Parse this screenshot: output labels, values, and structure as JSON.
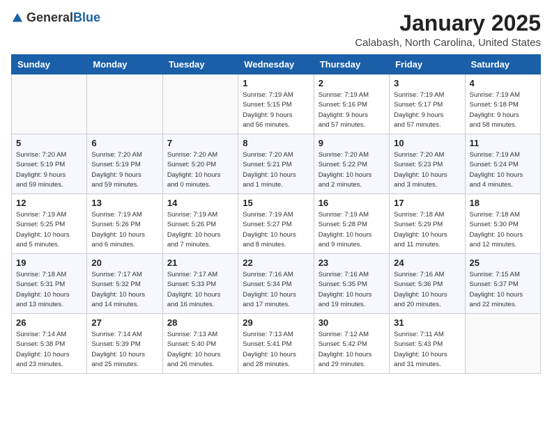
{
  "header": {
    "logo_general": "General",
    "logo_blue": "Blue",
    "month": "January 2025",
    "location": "Calabash, North Carolina, United States"
  },
  "weekdays": [
    "Sunday",
    "Monday",
    "Tuesday",
    "Wednesday",
    "Thursday",
    "Friday",
    "Saturday"
  ],
  "weeks": [
    [
      {
        "day": "",
        "info": ""
      },
      {
        "day": "",
        "info": ""
      },
      {
        "day": "",
        "info": ""
      },
      {
        "day": "1",
        "info": "Sunrise: 7:19 AM\nSunset: 5:15 PM\nDaylight: 9 hours\nand 56 minutes."
      },
      {
        "day": "2",
        "info": "Sunrise: 7:19 AM\nSunset: 5:16 PM\nDaylight: 9 hours\nand 57 minutes."
      },
      {
        "day": "3",
        "info": "Sunrise: 7:19 AM\nSunset: 5:17 PM\nDaylight: 9 hours\nand 57 minutes."
      },
      {
        "day": "4",
        "info": "Sunrise: 7:19 AM\nSunset: 5:18 PM\nDaylight: 9 hours\nand 58 minutes."
      }
    ],
    [
      {
        "day": "5",
        "info": "Sunrise: 7:20 AM\nSunset: 5:19 PM\nDaylight: 9 hours\nand 59 minutes."
      },
      {
        "day": "6",
        "info": "Sunrise: 7:20 AM\nSunset: 5:19 PM\nDaylight: 9 hours\nand 59 minutes."
      },
      {
        "day": "7",
        "info": "Sunrise: 7:20 AM\nSunset: 5:20 PM\nDaylight: 10 hours\nand 0 minutes."
      },
      {
        "day": "8",
        "info": "Sunrise: 7:20 AM\nSunset: 5:21 PM\nDaylight: 10 hours\nand 1 minute."
      },
      {
        "day": "9",
        "info": "Sunrise: 7:20 AM\nSunset: 5:22 PM\nDaylight: 10 hours\nand 2 minutes."
      },
      {
        "day": "10",
        "info": "Sunrise: 7:20 AM\nSunset: 5:23 PM\nDaylight: 10 hours\nand 3 minutes."
      },
      {
        "day": "11",
        "info": "Sunrise: 7:19 AM\nSunset: 5:24 PM\nDaylight: 10 hours\nand 4 minutes."
      }
    ],
    [
      {
        "day": "12",
        "info": "Sunrise: 7:19 AM\nSunset: 5:25 PM\nDaylight: 10 hours\nand 5 minutes."
      },
      {
        "day": "13",
        "info": "Sunrise: 7:19 AM\nSunset: 5:26 PM\nDaylight: 10 hours\nand 6 minutes."
      },
      {
        "day": "14",
        "info": "Sunrise: 7:19 AM\nSunset: 5:26 PM\nDaylight: 10 hours\nand 7 minutes."
      },
      {
        "day": "15",
        "info": "Sunrise: 7:19 AM\nSunset: 5:27 PM\nDaylight: 10 hours\nand 8 minutes."
      },
      {
        "day": "16",
        "info": "Sunrise: 7:19 AM\nSunset: 5:28 PM\nDaylight: 10 hours\nand 9 minutes."
      },
      {
        "day": "17",
        "info": "Sunrise: 7:18 AM\nSunset: 5:29 PM\nDaylight: 10 hours\nand 11 minutes."
      },
      {
        "day": "18",
        "info": "Sunrise: 7:18 AM\nSunset: 5:30 PM\nDaylight: 10 hours\nand 12 minutes."
      }
    ],
    [
      {
        "day": "19",
        "info": "Sunrise: 7:18 AM\nSunset: 5:31 PM\nDaylight: 10 hours\nand 13 minutes."
      },
      {
        "day": "20",
        "info": "Sunrise: 7:17 AM\nSunset: 5:32 PM\nDaylight: 10 hours\nand 14 minutes."
      },
      {
        "day": "21",
        "info": "Sunrise: 7:17 AM\nSunset: 5:33 PM\nDaylight: 10 hours\nand 16 minutes."
      },
      {
        "day": "22",
        "info": "Sunrise: 7:16 AM\nSunset: 5:34 PM\nDaylight: 10 hours\nand 17 minutes."
      },
      {
        "day": "23",
        "info": "Sunrise: 7:16 AM\nSunset: 5:35 PM\nDaylight: 10 hours\nand 19 minutes."
      },
      {
        "day": "24",
        "info": "Sunrise: 7:16 AM\nSunset: 5:36 PM\nDaylight: 10 hours\nand 20 minutes."
      },
      {
        "day": "25",
        "info": "Sunrise: 7:15 AM\nSunset: 5:37 PM\nDaylight: 10 hours\nand 22 minutes."
      }
    ],
    [
      {
        "day": "26",
        "info": "Sunrise: 7:14 AM\nSunset: 5:38 PM\nDaylight: 10 hours\nand 23 minutes."
      },
      {
        "day": "27",
        "info": "Sunrise: 7:14 AM\nSunset: 5:39 PM\nDaylight: 10 hours\nand 25 minutes."
      },
      {
        "day": "28",
        "info": "Sunrise: 7:13 AM\nSunset: 5:40 PM\nDaylight: 10 hours\nand 26 minutes."
      },
      {
        "day": "29",
        "info": "Sunrise: 7:13 AM\nSunset: 5:41 PM\nDaylight: 10 hours\nand 28 minutes."
      },
      {
        "day": "30",
        "info": "Sunrise: 7:12 AM\nSunset: 5:42 PM\nDaylight: 10 hours\nand 29 minutes."
      },
      {
        "day": "31",
        "info": "Sunrise: 7:11 AM\nSunset: 5:43 PM\nDaylight: 10 hours\nand 31 minutes."
      },
      {
        "day": "",
        "info": ""
      }
    ]
  ]
}
